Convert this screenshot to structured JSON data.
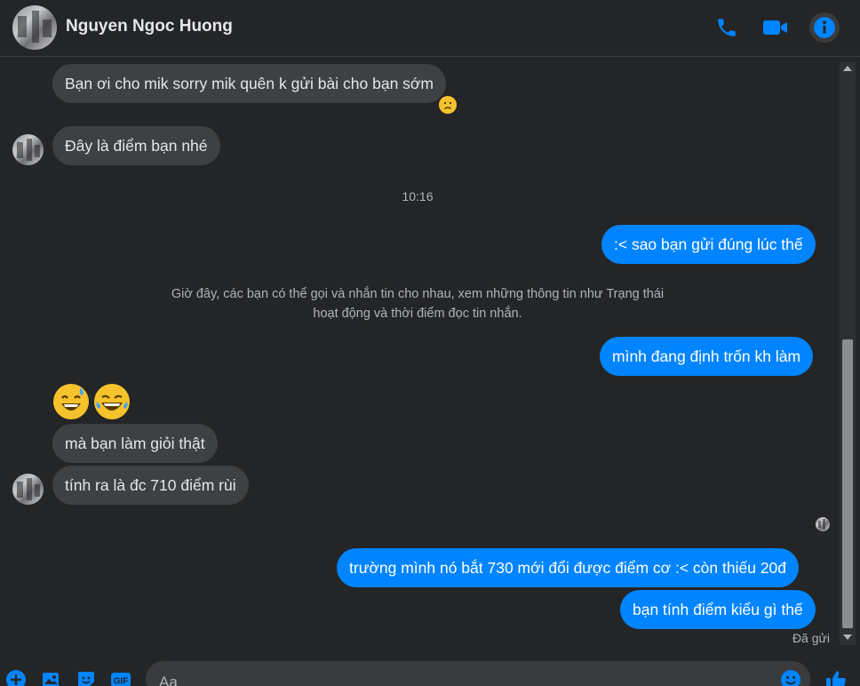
{
  "header": {
    "contact_name": "Nguyen Ngoc Huong",
    "icons": [
      "phone-icon",
      "video-camera-icon",
      "info-icon"
    ]
  },
  "colors": {
    "accent": "#0084ff",
    "background": "#242526",
    "incoming_bubble": "#3e4042",
    "outgoing_bubble": "#0084ff"
  },
  "messages": {
    "m1": "Bạn ơi cho mik sorry mik quên k gửi bài cho bạn sớm",
    "m2": "Đây là điểm bạn nhé",
    "m3": ":< sao bạn gửi đúng lúc thế",
    "m4": "mình đang định trốn kh làm",
    "m5": "mà bạn làm giỏi thật",
    "m6": "tính ra là đc 710 điểm rùi",
    "m7": "trường mình nó bắt 730 mới đổi được điểm cơ :< còn thiếu 20đ",
    "m8": "bạn tính điểm kiểu gì thế"
  },
  "timestamp": "10:16",
  "notice": {
    "line1": "Giờ đây, các bạn có thể gọi và nhắn tin cho nhau, xem những thông tin như Trạng thái",
    "line2": "hoạt động và thời điểm đọc tin nhắn."
  },
  "reactions": {
    "m1": "crying-face-emoji"
  },
  "emoji_row": [
    "grinning-sweat-emoji",
    "tears-of-joy-emoji"
  ],
  "status": "Đã gửi",
  "composer": {
    "placeholder": "Aa",
    "icons": [
      "add-icon",
      "image-icon",
      "sticker-icon",
      "gif-icon",
      "emoji-icon",
      "like-icon"
    ]
  }
}
